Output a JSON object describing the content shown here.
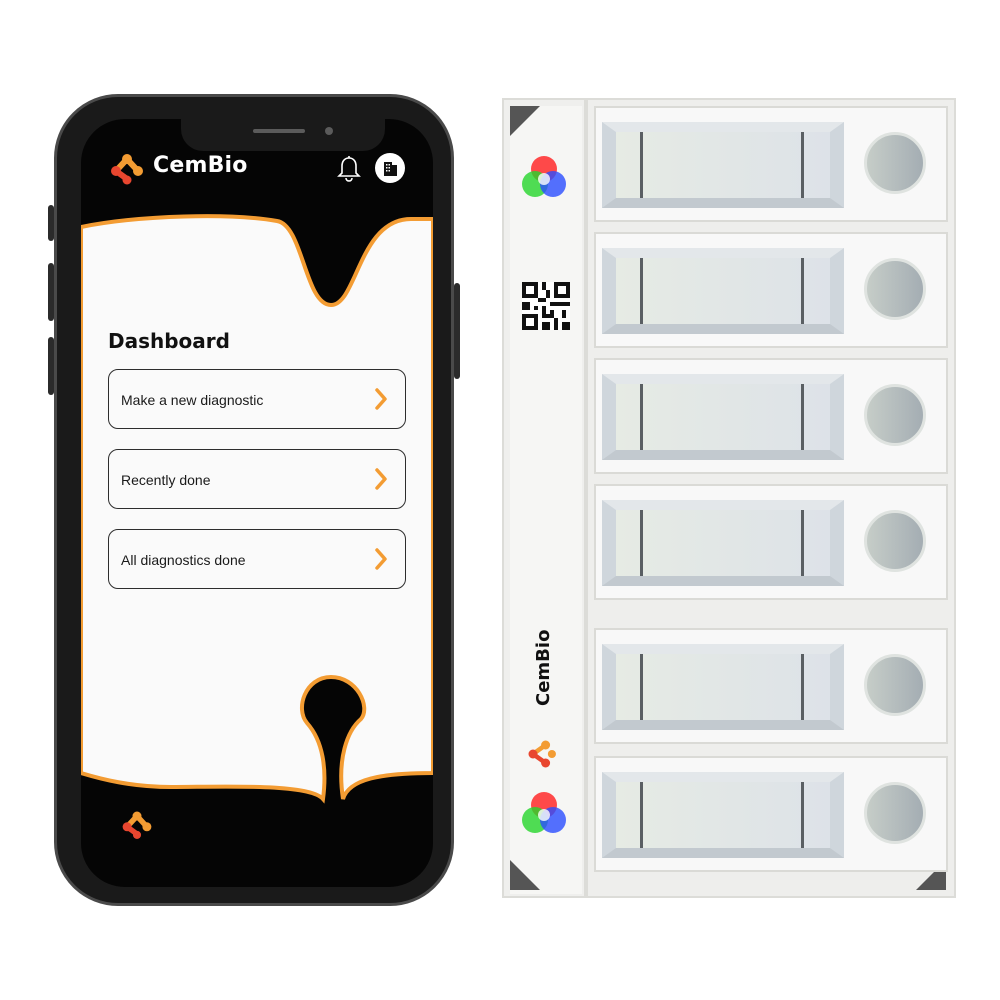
{
  "app": {
    "brand_name": "CemBio"
  },
  "colors": {
    "accent_orange": "#f39c33",
    "accent_red": "#e8462f",
    "screen_bg": "#050505",
    "content_bg": "#fafafa"
  },
  "header": {
    "logo_icon": "cembio-logo-icon",
    "notification_icon": "bell-icon",
    "avatar_icon": "building-icon"
  },
  "dashboard": {
    "title": "Dashboard",
    "items": [
      {
        "label": "Make a new diagnostic",
        "icon": "chevron-right-icon"
      },
      {
        "label": "Recently done",
        "icon": "chevron-right-icon"
      },
      {
        "label": "All diagnostics done",
        "icon": "chevron-right-icon"
      }
    ]
  },
  "device": {
    "brand_label": "CemBio",
    "slot_count": 6,
    "rail_icons": [
      "rgb-circles-icon",
      "qr-code-icon",
      "cembio-logo-icon",
      "rgb-circles-icon"
    ]
  }
}
